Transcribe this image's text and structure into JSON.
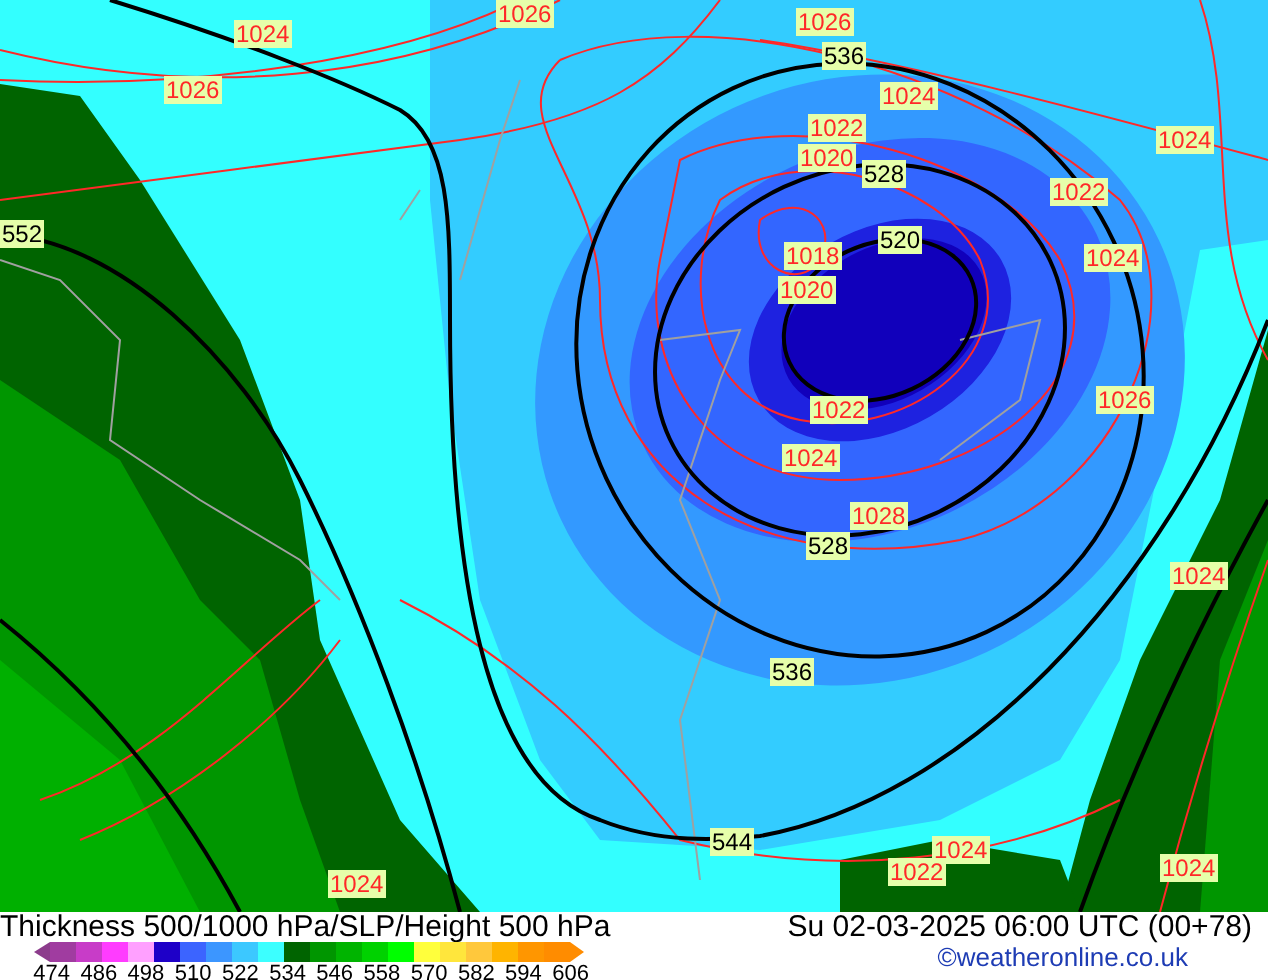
{
  "map": {
    "labels": [
      {
        "text": "1026",
        "kind": "isobar"
      },
      {
        "text": "1024",
        "kind": "isobar"
      },
      {
        "text": "1026",
        "kind": "isobar"
      },
      {
        "text": "1026",
        "kind": "isobar"
      },
      {
        "text": "536",
        "kind": "height"
      },
      {
        "text": "1024",
        "kind": "isobar"
      },
      {
        "text": "1022",
        "kind": "isobar"
      },
      {
        "text": "1020",
        "kind": "isobar"
      },
      {
        "text": "528",
        "kind": "height"
      },
      {
        "text": "1024",
        "kind": "isobar"
      },
      {
        "text": "1022",
        "kind": "isobar"
      },
      {
        "text": "552",
        "kind": "height"
      },
      {
        "text": "520",
        "kind": "height"
      },
      {
        "text": "1018",
        "kind": "isobar"
      },
      {
        "text": "1024",
        "kind": "isobar"
      },
      {
        "text": "1020",
        "kind": "isobar"
      },
      {
        "text": "1026",
        "kind": "isobar"
      },
      {
        "text": "1022",
        "kind": "isobar"
      },
      {
        "text": "1024",
        "kind": "isobar"
      },
      {
        "text": "1028",
        "kind": "isobar"
      },
      {
        "text": "528",
        "kind": "height"
      },
      {
        "text": "1024",
        "kind": "isobar"
      },
      {
        "text": "536",
        "kind": "height"
      },
      {
        "text": "544",
        "kind": "height"
      },
      {
        "text": "1024",
        "kind": "isobar"
      },
      {
        "text": "1022",
        "kind": "isobar"
      },
      {
        "text": "1024",
        "kind": "isobar"
      },
      {
        "text": "1024",
        "kind": "isobar"
      }
    ]
  },
  "footer": {
    "title": "Thickness 500/1000 hPa/SLP/Height 500 hPa",
    "datetime": "Su 02-03-2025 06:00 UTC (00+78)",
    "credit": "©weatheronline.co.uk",
    "legend": {
      "colors": [
        {
          "color": "#a03ca0"
        },
        {
          "color": "#c83cc8"
        },
        {
          "color": "#ff3cff"
        },
        {
          "color": "#ffa0ff"
        },
        {
          "color": "#1e00c8"
        },
        {
          "color": "#3c64ff"
        },
        {
          "color": "#3c96ff"
        },
        {
          "color": "#3cc8ff"
        },
        {
          "color": "#3cffff"
        },
        {
          "color": "#006400"
        },
        {
          "color": "#009600"
        },
        {
          "color": "#00b400"
        },
        {
          "color": "#00d200"
        },
        {
          "color": "#00ff00"
        },
        {
          "color": "#ffff3c"
        },
        {
          "color": "#ffe63c"
        },
        {
          "color": "#ffc83c"
        },
        {
          "color": "#ffb400"
        },
        {
          "color": "#ff9600"
        },
        {
          "color": "#ff8c00"
        }
      ],
      "ticks": [
        "474",
        "486",
        "498",
        "510",
        "522",
        "534",
        "546",
        "558",
        "570",
        "582",
        "594",
        "606"
      ]
    }
  }
}
